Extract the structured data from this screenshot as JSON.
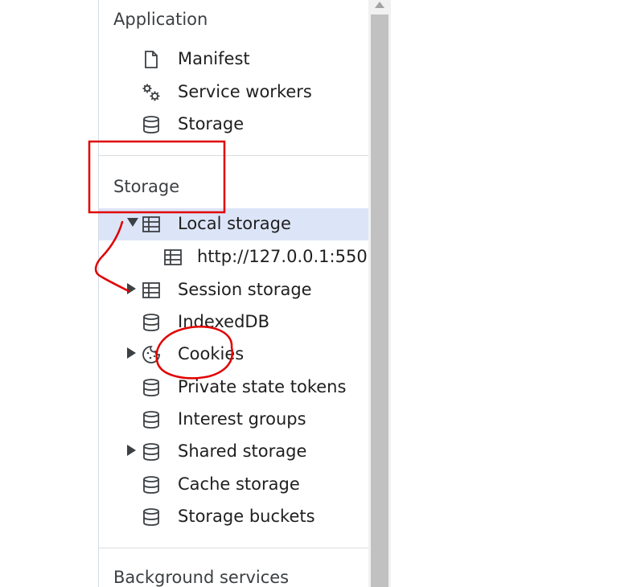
{
  "application": {
    "title": "Application",
    "items": [
      {
        "label": "Manifest",
        "icon": "document-icon"
      },
      {
        "label": "Service workers",
        "icon": "gears-icon"
      },
      {
        "label": "Storage",
        "icon": "database-icon"
      }
    ]
  },
  "storage": {
    "title": "Storage",
    "items": [
      {
        "label": "Local storage",
        "icon": "table-icon"
      },
      {
        "label": "http://127.0.0.1:550",
        "icon": "table-icon"
      },
      {
        "label": "Session storage",
        "icon": "table-icon"
      },
      {
        "label": "IndexedDB",
        "icon": "database-icon"
      },
      {
        "label": "Cookies",
        "icon": "cookie-icon"
      },
      {
        "label": "Private state tokens",
        "icon": "database-icon"
      },
      {
        "label": "Interest groups",
        "icon": "database-icon"
      },
      {
        "label": "Shared storage",
        "icon": "database-icon"
      },
      {
        "label": "Cache storage",
        "icon": "database-icon"
      },
      {
        "label": "Storage buckets",
        "icon": "database-icon"
      }
    ]
  },
  "background_services": {
    "title": "Background services"
  },
  "colors": {
    "selected_row": "#dce5f8",
    "annotation": "#e00000"
  }
}
